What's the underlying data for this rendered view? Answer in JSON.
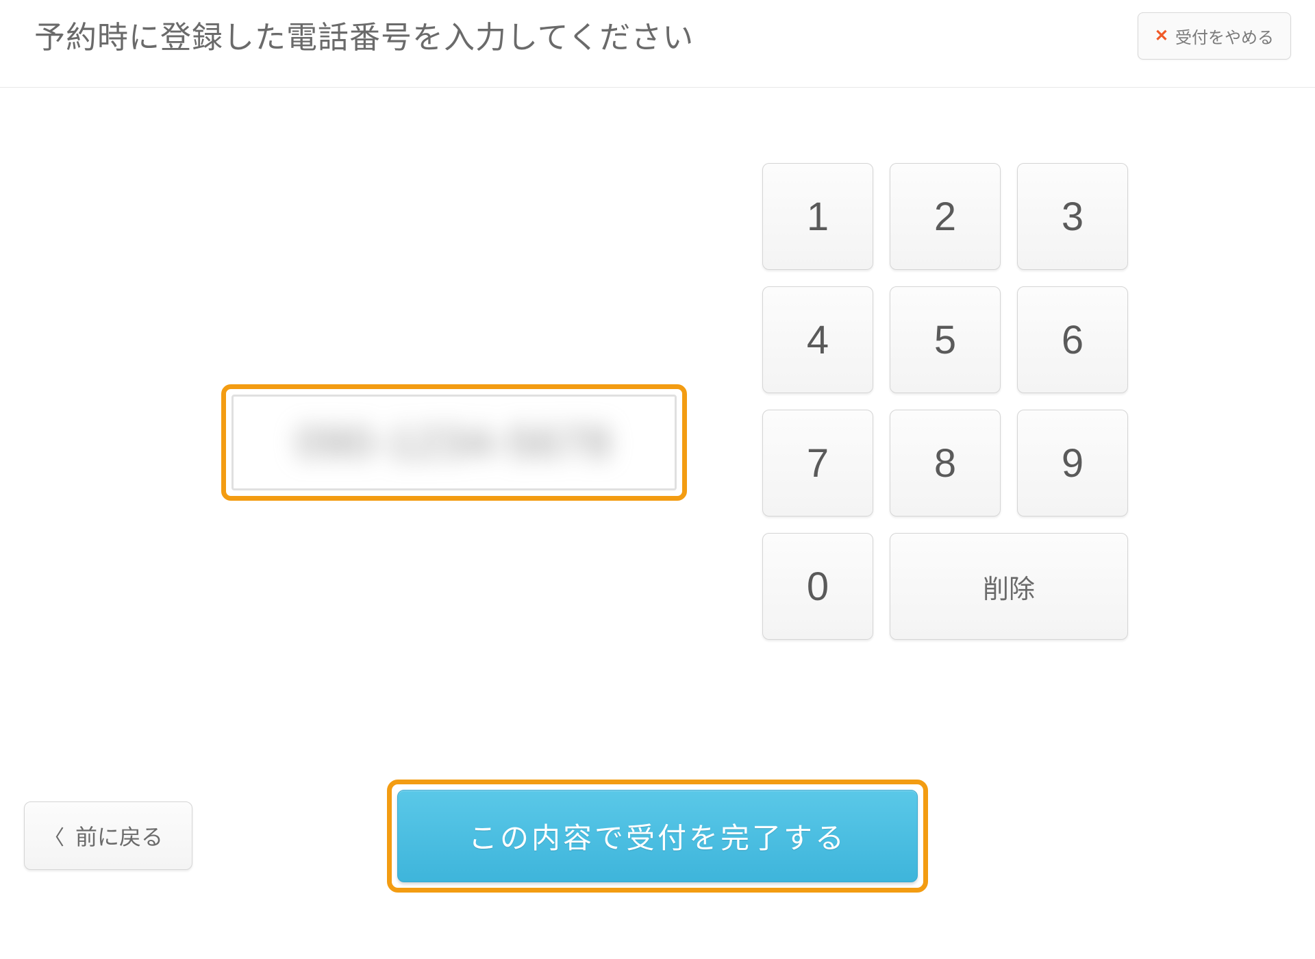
{
  "header": {
    "title": "予約時に登録した電話番号を入力してください",
    "cancel_label": "受付をやめる"
  },
  "phone_input": {
    "value": "090-1234-5678"
  },
  "keypad": {
    "keys": [
      "1",
      "2",
      "3",
      "4",
      "5",
      "6",
      "7",
      "8",
      "9",
      "0"
    ],
    "delete_label": "削除"
  },
  "footer": {
    "back_label": "前に戻る",
    "submit_label": "この内容で受付を完了する"
  },
  "colors": {
    "highlight": "#f39c12",
    "primary": "#3eb5db",
    "text": "#6a6a6a"
  }
}
